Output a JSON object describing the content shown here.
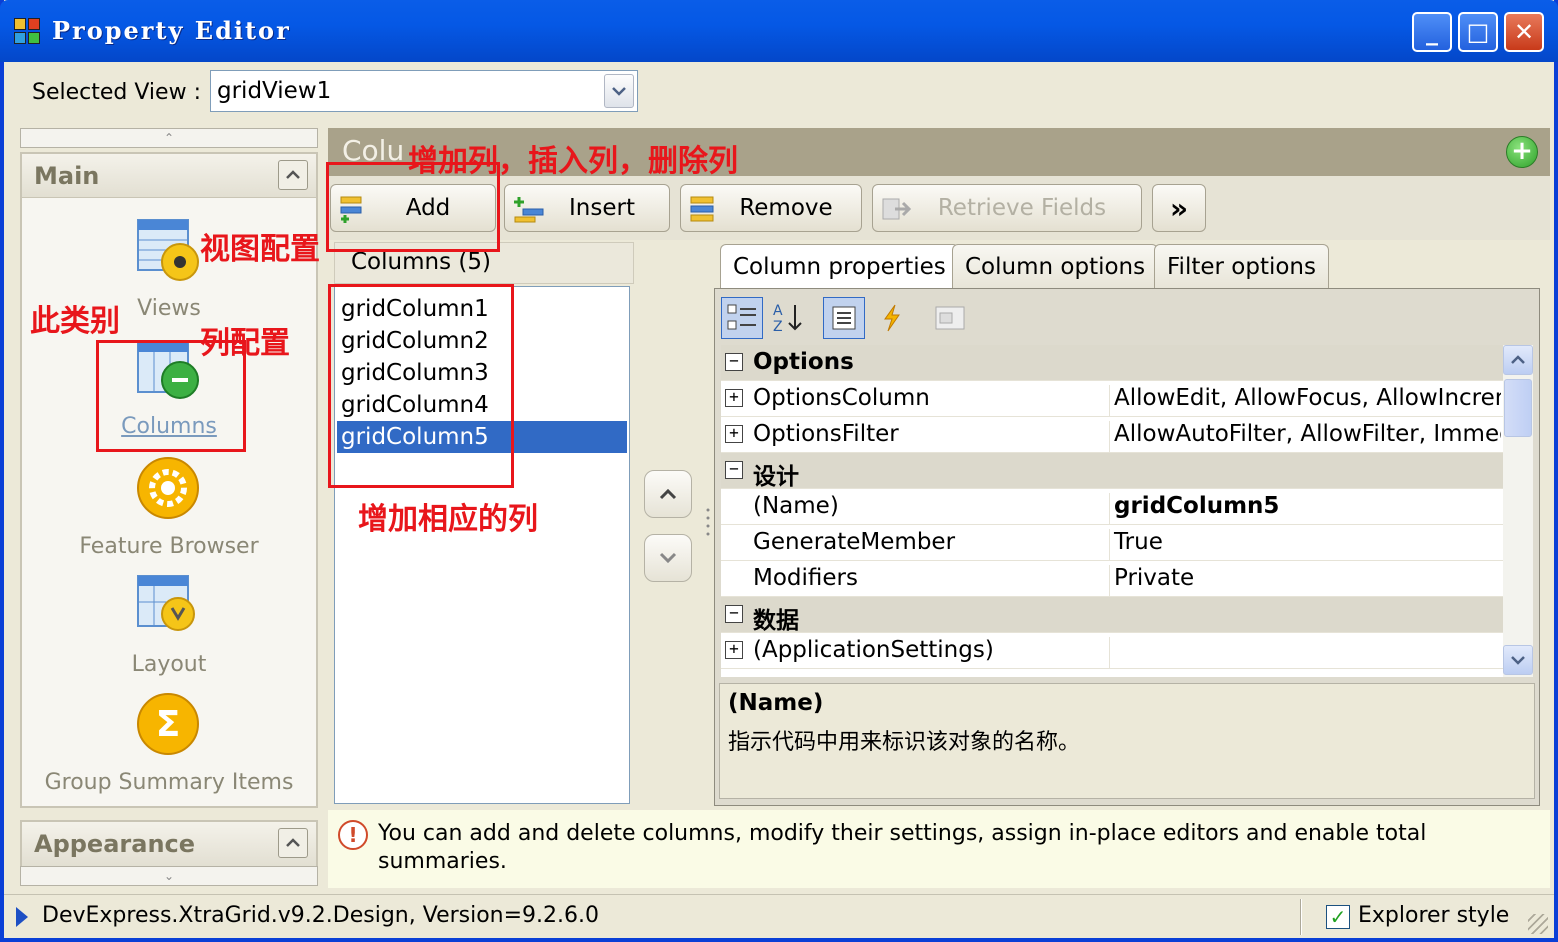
{
  "window": {
    "title": "Property Editor",
    "minimize": "_",
    "maximize": "□",
    "close": "✕"
  },
  "selector": {
    "label": "Selected View :",
    "value": "gridView1"
  },
  "nav": {
    "groups": [
      {
        "label": "Main",
        "items": [
          {
            "label": "Views",
            "icon": "views-icon"
          },
          {
            "label": "Columns",
            "icon": "columns-icon",
            "active": true
          },
          {
            "label": "Feature Browser",
            "icon": "gear-icon"
          },
          {
            "label": "Layout",
            "icon": "layout-icon"
          },
          {
            "label": "Group Summary Items",
            "icon": "sigma-icon"
          }
        ]
      },
      {
        "label": "Appearance"
      }
    ]
  },
  "main": {
    "header_title": "Colu",
    "toolbar": {
      "add": "Add",
      "insert": "Insert",
      "remove": "Remove",
      "retrieve": "Retrieve Fields",
      "more": "»"
    },
    "columns_header": "Columns (5)",
    "columns": [
      "gridColumn1",
      "gridColumn2",
      "gridColumn3",
      "gridColumn4",
      "gridColumn5"
    ],
    "selected_column": "gridColumn5"
  },
  "properties": {
    "tabs": [
      "Column properties",
      "Column options",
      "Filter options"
    ],
    "active_tab": "Column properties",
    "rows": [
      {
        "type": "category",
        "expander": "−",
        "name": "Options",
        "value": ""
      },
      {
        "type": "prop",
        "expander": "+",
        "name": "OptionsColumn",
        "value": "AllowEdit, AllowFocus, AllowIncrem"
      },
      {
        "type": "prop",
        "expander": "+",
        "name": "OptionsFilter",
        "value": "AllowAutoFilter, AllowFilter, Immedi"
      },
      {
        "type": "category",
        "expander": "−",
        "name": "设计",
        "value": ""
      },
      {
        "type": "prop",
        "expander": "",
        "name": "(Name)",
        "value": "gridColumn5",
        "bold": true
      },
      {
        "type": "prop",
        "expander": "",
        "name": "GenerateMember",
        "value": "True"
      },
      {
        "type": "prop",
        "expander": "",
        "name": "Modifiers",
        "value": "Private"
      },
      {
        "type": "category",
        "expander": "−",
        "name": "数据",
        "value": ""
      },
      {
        "type": "prop",
        "expander": "+",
        "name": "(ApplicationSettings)",
        "value": ""
      }
    ],
    "description": {
      "title": "(Name)",
      "text": "指示代码中用来标识该对象的名称。"
    }
  },
  "hint": {
    "icon": "!",
    "text": "You can add and delete columns, modify their settings, assign in-place editors and enable total summaries."
  },
  "status": {
    "text": "DevExpress.XtraGrid.v9.2.Design, Version=9.2.6.0",
    "checkbox_label": "Explorer style",
    "checked": true
  },
  "annotations": {
    "toolbar_note": "增加列，插入列，删除列",
    "view_config": "视图配置",
    "this_category": "此类别",
    "column_config": "列配置",
    "add_columns": "增加相应的列"
  },
  "colors": {
    "titlebar": "#0558e5",
    "selection": "#316ac5",
    "annotation_red": "#e8161b",
    "panel_header": "#a9a28a"
  }
}
